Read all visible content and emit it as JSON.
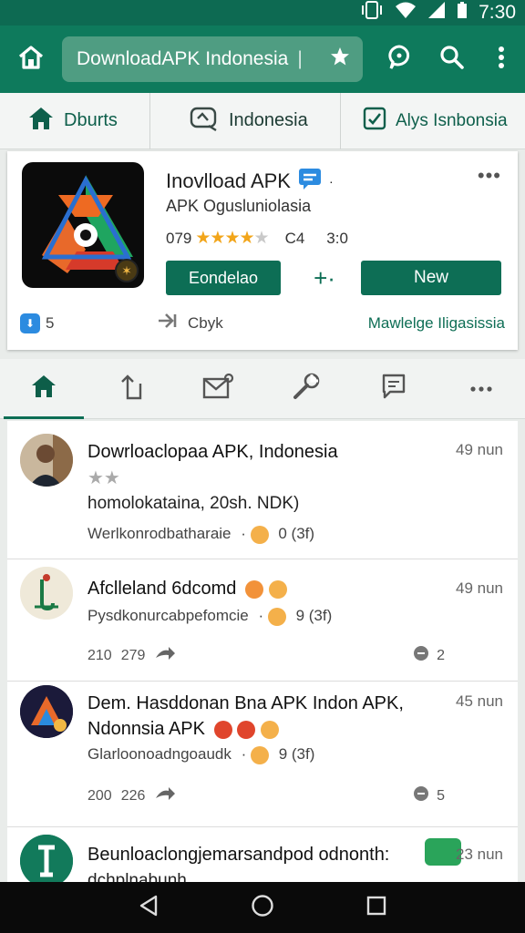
{
  "status_bar": {
    "time": "7:30"
  },
  "toolbar": {
    "url_text": "DownloadAPK Indonesia"
  },
  "filters": [
    {
      "label": "Dburts"
    },
    {
      "label": "Indonesia"
    },
    {
      "label": "Alys Isnbonsia"
    }
  ],
  "app_card": {
    "title": "Inovlload APK",
    "subtitle": "APK Ogusluniolasia",
    "rating_count": "079",
    "meta_a": "C4",
    "meta_b": "3:0",
    "rating": 4,
    "primary_button": "Eondelao",
    "secondary_symbol": "+·",
    "new_button": "New",
    "foot_left": "5",
    "foot_mid": "Cbyk",
    "foot_right": "Mawlelge Iligasissia"
  },
  "tabs": [
    "home",
    "share",
    "mail",
    "tools",
    "comments",
    "more"
  ],
  "posts": [
    {
      "title": "Dowrloaclopaa APK, Indonesia",
      "time": "49 nun",
      "line1": "homolokataina, 20sh. NDK)",
      "line2": "Werlkonrodbatharaie",
      "reactions": "0 (3f)"
    },
    {
      "title": "Afclleland 6dcomd",
      "time": "49 nun",
      "line1": "Pysdkonurcabpefomcie",
      "reactions": "9 (3f)",
      "stat_a": "210",
      "stat_b": "279",
      "right_count": "2"
    },
    {
      "title": "Dem. Hasddonan Bna APK Indon APK, Ndonnsia APK",
      "time": "45 nun",
      "line1": "Glarloonoadngoaudk",
      "reactions": "9 (3f)",
      "stat_a": "200",
      "stat_b": "226",
      "right_count": "5"
    },
    {
      "title": "Beunloaclongjemarsandpod odnonth:",
      "time": "23 nun",
      "line1": "dchplnabunh"
    }
  ],
  "colors": {
    "brand_green": "#0e7a5c",
    "button_green": "#0d6e55",
    "star_orange": "#f2a51a"
  }
}
